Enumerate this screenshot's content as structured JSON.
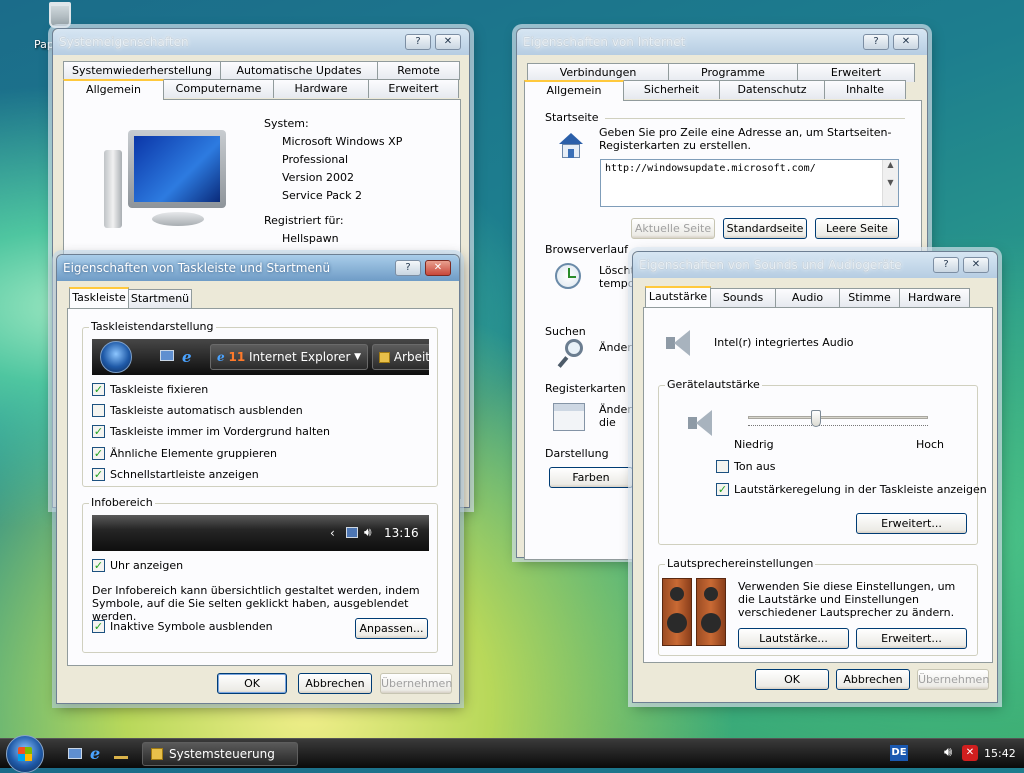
{
  "desktop": {
    "recycle_label": "Papierkorb"
  },
  "sys_win": {
    "title": "Systemeigenschaften",
    "help": "?",
    "close": "✕",
    "tabs_back": [
      "Systemwiederherstellung",
      "Automatische Updates",
      "Remote"
    ],
    "tabs_front": [
      "Allgemein",
      "Computername",
      "Hardware",
      "Erweitert"
    ],
    "system_label": "System:",
    "system_lines": [
      "Microsoft Windows XP",
      "Professional",
      "Version 2002",
      "Service Pack 2"
    ],
    "reg_label": "Registriert für:",
    "reg_user": "Hellspawn"
  },
  "ie_win": {
    "title": "Eigenschaften von Internet",
    "help": "?",
    "close": "✕",
    "tabs_back": [
      "Verbindungen",
      "Programme",
      "Erweitert"
    ],
    "tabs_front": [
      "Allgemein",
      "Sicherheit",
      "Datenschutz",
      "Inhalte"
    ],
    "startseite": "Startseite",
    "startseite_desc": "Geben Sie pro Zeile eine Adresse an, um Startseiten-Registerkarten zu erstellen.",
    "url": "http://windowsupdate.microsoft.com/",
    "btn_aktuell": "Aktuelle Seite",
    "btn_standard": "Standardseite",
    "btn_leer": "Leere Seite",
    "browserverlauf": "Browserverlauf",
    "verlauf_desc": "Löscht temporäre Dateien, Verlauf, Cookies, gespeicherte Kennwörter und Webformulardaten.",
    "suchen": "Suchen",
    "suchen_desc": "Ändert Suchstandards.",
    "registerkarten": "Registerkarten",
    "reg_desc": "Ändert die Anzeige von Webseiten in Registerkarten.",
    "darstellung": "Darstellung",
    "btn_farben": "Farben"
  },
  "task_win": {
    "title": "Eigenschaften von Taskleiste und Startmenü",
    "help": "?",
    "close": "✕",
    "tabs": [
      "Taskleiste",
      "Startmenü"
    ],
    "grp1": "Taskleistendarstellung",
    "preview_ie": "Internet Explorer",
    "preview_ie_num": "11",
    "preview_arb": "Arbeit",
    "checks": [
      {
        "label": "Taskleiste fixieren",
        "checked": true
      },
      {
        "label": "Taskleiste automatisch ausblenden",
        "checked": false
      },
      {
        "label": "Taskleiste immer im Vordergrund halten",
        "checked": true
      },
      {
        "label": "Ähnliche Elemente gruppieren",
        "checked": true
      },
      {
        "label": "Schnellstartleiste anzeigen",
        "checked": true
      }
    ],
    "grp2": "Infobereich",
    "tray_time": "13:16",
    "clock_check": "Uhr anzeigen",
    "info_text": "Der Infobereich kann übersichtlich gestaltet werden, indem Symbole, auf die Sie selten geklickt haben, ausgeblendet werden.",
    "hide_check": "Inaktive Symbole ausblenden",
    "btn_anpassen": "Anpassen...",
    "ok": "OK",
    "cancel": "Abbrechen",
    "apply": "Übernehmen"
  },
  "sound_win": {
    "title": "Eigenschaften von Sounds und Audiogeräte",
    "help": "?",
    "close": "✕",
    "tabs": [
      "Lautstärke",
      "Sounds",
      "Audio",
      "Stimme",
      "Hardware"
    ],
    "device": "Intel(r) integriertes Audio",
    "grp_vol": "Gerätelautstärke",
    "low": "Niedrig",
    "high": "Hoch",
    "volume_level": 0.37,
    "mute": "Ton aus",
    "tray_check": "Lautstärkeregelung in der Taskleiste anzeigen",
    "btn_erweitert": "Erweitert...",
    "grp_spk": "Lautsprechereinstellungen",
    "spk_desc": "Verwenden Sie diese Einstellungen, um die Lautstärke und Einstellungen verschiedener Lautsprecher zu ändern.",
    "btn_laut": "Lautstärke...",
    "btn_erw2": "Erweitert...",
    "ok": "OK",
    "cancel": "Abbrechen",
    "apply": "Übernehmen"
  },
  "taskbar": {
    "task_label": "Systemsteuerung",
    "lang": "DE",
    "clock": "15:42"
  }
}
